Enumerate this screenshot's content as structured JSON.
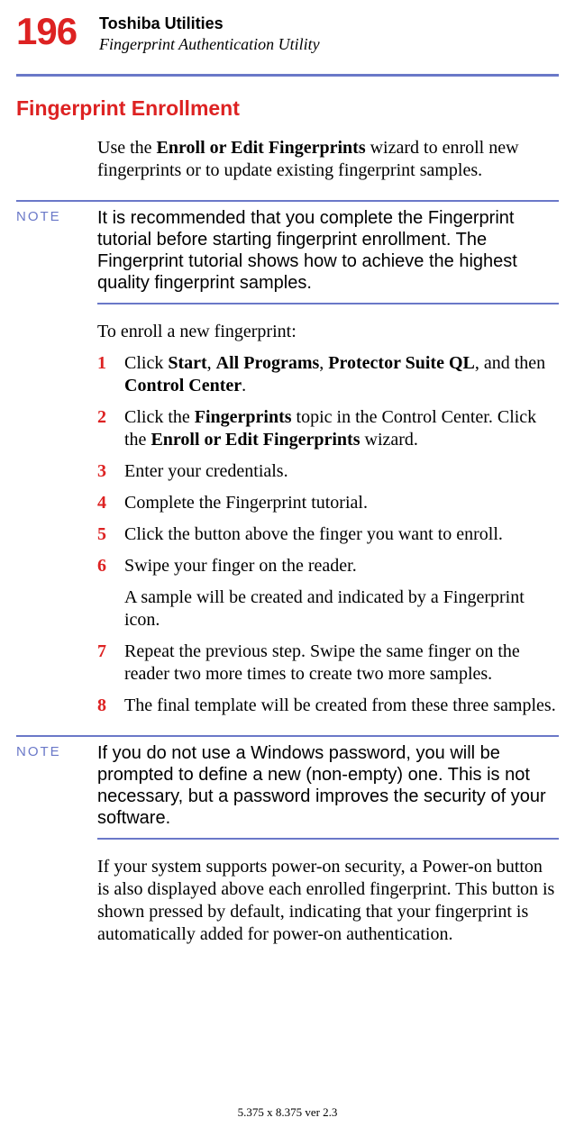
{
  "header": {
    "page_number": "196",
    "chapter": "Toshiba Utilities",
    "section": "Fingerprint Authentication Utility"
  },
  "heading": "Fingerprint Enrollment",
  "intro": {
    "pre": "Use the ",
    "bold1": "Enroll or Edit Fingerprints",
    "post": " wizard to enroll new fingerprints or to update existing fingerprint samples."
  },
  "note1": {
    "label": "NOTE",
    "text": "It is recommended that you complete the Fingerprint tutorial before starting fingerprint enrollment. The Fingerprint tutorial shows how to achieve the highest quality fingerprint samples."
  },
  "pre_steps": "To enroll a new fingerprint:",
  "steps": [
    {
      "n": "1",
      "pre": "Click ",
      "b1": "Start",
      "m1": ", ",
      "b2": "All Programs",
      "m2": ", ",
      "b3": "Protector Suite QL",
      "m3": ", and then ",
      "b4": "Control Center",
      "post": "."
    },
    {
      "n": "2",
      "pre": "Click the ",
      "b1": "Fingerprints",
      "m1": " topic in the Control Center. Click the ",
      "b2": "Enroll or Edit Fingerprints",
      "post": " wizard."
    },
    {
      "n": "3",
      "text": "Enter your credentials."
    },
    {
      "n": "4",
      "text": "Complete the Fingerprint tutorial."
    },
    {
      "n": "5",
      "text": "Click the button above the finger you want to enroll."
    },
    {
      "n": "6",
      "text": "Swipe your finger on the reader.",
      "extra": "A sample will be created and indicated by a Fingerprint icon."
    },
    {
      "n": "7",
      "text": "Repeat the previous step. Swipe the same finger on the reader two more times to create two more samples."
    },
    {
      "n": "8",
      "text": "The final template will be created from these three samples."
    }
  ],
  "note2": {
    "label": "NOTE",
    "text": "If you do not use a Windows password, you will be prompted to define a new (non-empty) one. This is not necessary, but a password improves the security of your software."
  },
  "closing": "If your system supports power-on security, a Power-on button is also displayed above each enrolled fingerprint. This button is shown pressed by default, indicating that your fingerprint is automatically added for power-on authentication.",
  "footer": "5.375 x 8.375 ver 2.3"
}
